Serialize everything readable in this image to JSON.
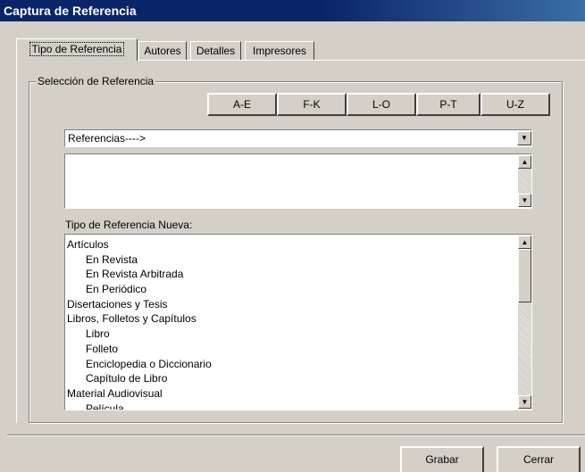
{
  "window": {
    "title": "Captura de Referencia"
  },
  "tabs": [
    {
      "label": "Tipo de Referencia",
      "active": true
    },
    {
      "label": "Autores"
    },
    {
      "label": "Detalles"
    },
    {
      "label": "Impresores"
    }
  ],
  "selection_group": {
    "label": "Selección de Referencia",
    "alpha_buttons": [
      "A-E",
      "F-K",
      "L-O",
      "P-T",
      "U-Z"
    ],
    "combo_value": "Referencias---->",
    "combo_arrow_icon": "chevron-down-icon"
  },
  "new_type": {
    "label": "Tipo de Referencia Nueva:",
    "items": [
      {
        "text": "Artículos",
        "level": 0
      },
      {
        "text": "En Revista",
        "level": 1
      },
      {
        "text": "En Revista Arbitrada",
        "level": 1
      },
      {
        "text": "En Periódico",
        "level": 1
      },
      {
        "text": "Disertaciones y Tesis",
        "level": 0
      },
      {
        "text": "Libros, Folletos y Capítulos",
        "level": 0
      },
      {
        "text": "Libro",
        "level": 1
      },
      {
        "text": "Folleto",
        "level": 1
      },
      {
        "text": "Enciclopedia o Diccionario",
        "level": 1
      },
      {
        "text": "Capítulo de Libro",
        "level": 1
      },
      {
        "text": "Material Audiovisual",
        "level": 0
      },
      {
        "text": "Película",
        "level": 1
      }
    ]
  },
  "buttons": {
    "save": "Grabar",
    "close": "Cerrar"
  }
}
